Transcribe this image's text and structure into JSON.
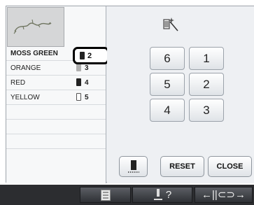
{
  "thread_list": [
    {
      "name": "MOSS GREEN",
      "number": "2",
      "spool": "dark"
    },
    {
      "name": "ORANGE",
      "number": "3",
      "spool": "mid"
    },
    {
      "name": "RED",
      "number": "4",
      "spool": "dark"
    },
    {
      "name": "YELLOW",
      "number": "5",
      "spool": "light"
    }
  ],
  "current_needle": {
    "number": "2"
  },
  "keypad": {
    "k6": "6",
    "k1": "1",
    "k5": "5",
    "k2": "2",
    "k4": "4",
    "k3": "3"
  },
  "buttons": {
    "reset": "RESET",
    "close": "CLOSE"
  },
  "taskbar": {
    "help": "?",
    "frame_move": "←||⊂⊃→"
  }
}
